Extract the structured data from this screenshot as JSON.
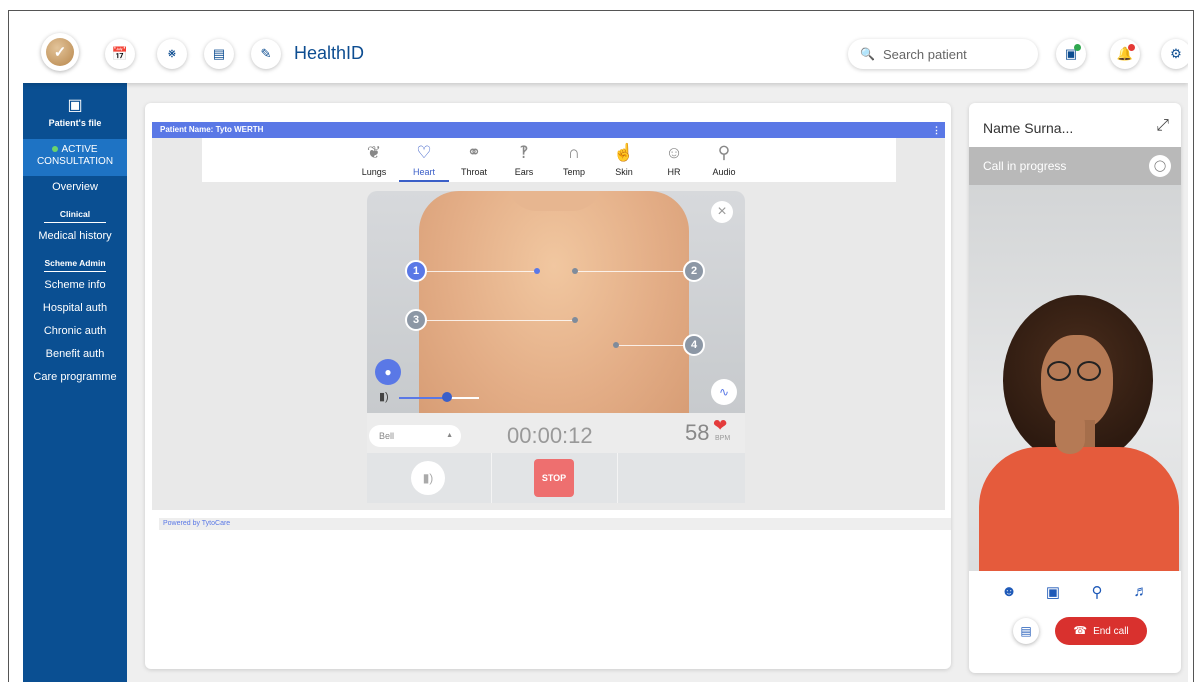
{
  "header": {
    "title": "HealthID",
    "search_placeholder": "Search patient",
    "nav_icons": [
      "calendar-icon",
      "people-icon",
      "card-icon",
      "clipboard-icon"
    ],
    "right_icons": [
      "screen-share-icon",
      "notification-icon",
      "settings-icon"
    ],
    "status_colors": {
      "screen_share_dot": "#2fa84f",
      "notification_dot": "#e53935"
    }
  },
  "sidebar": {
    "head_label": "Patient's file",
    "active_label": "ACTIVE CONSULTATION",
    "overview": "Overview",
    "clinical_heading": "Clinical",
    "clinical_items": [
      "Medical history"
    ],
    "scheme_heading": "Scheme Admin",
    "scheme_items": [
      "Scheme info",
      "Hospital auth",
      "Chronic auth",
      "Benefit auth",
      "Care programme"
    ]
  },
  "exam": {
    "patient_name": "Patient Name: Tyto WERTH",
    "tabs": [
      "Lungs",
      "Heart",
      "Throat",
      "Ears",
      "Temp",
      "Skin",
      "HR",
      "Audio"
    ],
    "active_tab": "Heart",
    "points": [
      "1",
      "2",
      "3",
      "4"
    ],
    "filter": "Bell",
    "timer": "00:00:12",
    "bpm_value": "58",
    "bpm_unit": "BPM",
    "stop_label": "STOP",
    "volume_level": 0.6,
    "powered_by": "Powered by TytoCare"
  },
  "call": {
    "name": "Name Surna...",
    "status": "Call in progress",
    "end_label": "End call",
    "end_color": "#d9312e"
  }
}
